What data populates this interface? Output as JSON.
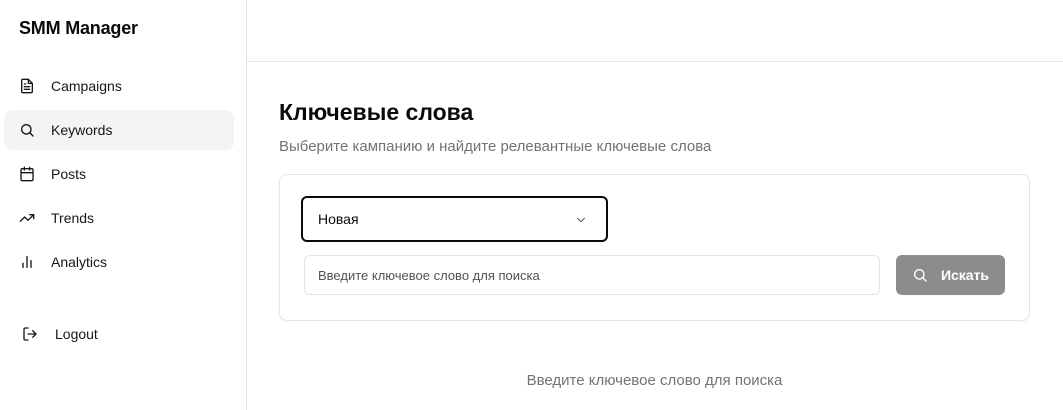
{
  "sidebar": {
    "brand": "SMM Manager",
    "items": [
      {
        "label": "Campaigns",
        "icon": "file-text-icon",
        "active": false
      },
      {
        "label": "Keywords",
        "icon": "search-icon",
        "active": true
      },
      {
        "label": "Posts",
        "icon": "calendar-icon",
        "active": false
      },
      {
        "label": "Trends",
        "icon": "trending-up-icon",
        "active": false
      },
      {
        "label": "Analytics",
        "icon": "bar-chart-icon",
        "active": false
      }
    ],
    "logout": {
      "label": "Logout",
      "icon": "log-out-icon"
    }
  },
  "main": {
    "title": "Ключевые слова",
    "subtitle": "Выберите кампанию и найдите релевантные ключевые слова",
    "campaign_select": {
      "value": "Новая"
    },
    "search": {
      "placeholder": "Введите ключевое слово для поиска",
      "value": "",
      "button_label": "Искать"
    },
    "empty_hint": "Введите ключевое слово для поиска"
  },
  "colors": {
    "active_nav_bg": "#f4f4f3",
    "button_bg": "#8c8c8e",
    "muted_text": "#737373",
    "border": "#e5e5e5"
  }
}
